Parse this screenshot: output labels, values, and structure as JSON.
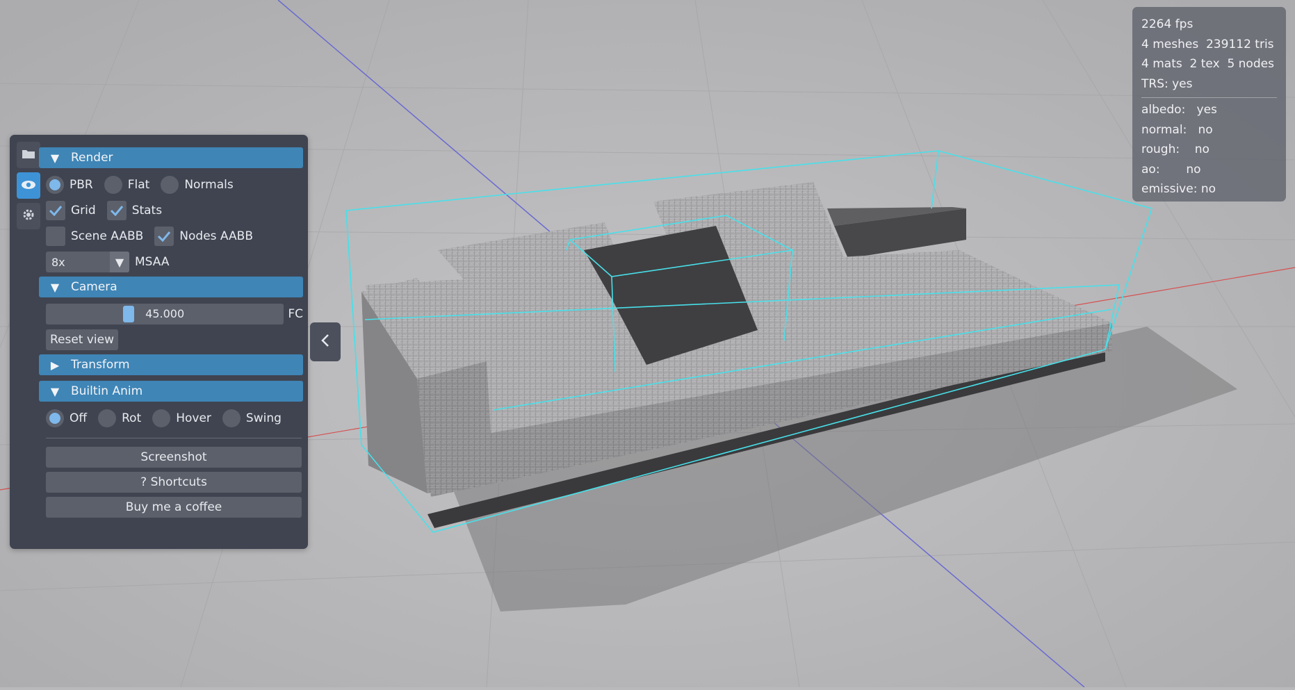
{
  "panel": {
    "tabs": [
      "folder-icon",
      "eye-icon",
      "gear-icon"
    ],
    "render": {
      "header": "Render",
      "shading_options": [
        "PBR",
        "Flat",
        "Normals"
      ],
      "shading_selected": "PBR",
      "checks": [
        {
          "label": "Grid",
          "checked": true
        },
        {
          "label": "Stats",
          "checked": true
        },
        {
          "label": "Scene AABB",
          "checked": false
        },
        {
          "label": "Nodes AABB",
          "checked": true
        }
      ],
      "msaa_value": "8x",
      "msaa_label": "MSAA"
    },
    "camera": {
      "header": "Camera",
      "fov_value": "45.000",
      "fov_label": "FC",
      "reset_label": "Reset view"
    },
    "transform": {
      "header": "Transform"
    },
    "anim": {
      "header": "Builtin Anim",
      "options": [
        "Off",
        "Rot",
        "Hover",
        "Swing"
      ],
      "selected": "Off"
    },
    "buttons": {
      "screenshot": "Screenshot",
      "shortcuts": "? Shortcuts",
      "coffee": "Buy me a coffee"
    }
  },
  "stats": {
    "fps": "2264 fps",
    "meshes": "4 meshes  239112 tris",
    "mats": "4 mats  2 tex  5 nodes",
    "trs": "TRS: yes",
    "albedo": "albedo:   yes",
    "normal": "normal:   no",
    "rough": "rough:    no",
    "ao": "ao:       no",
    "emissive": "emissive: no"
  },
  "colors": {
    "accent": "#3f85b6",
    "aabb": "#48e0ea",
    "panel_bg": "#3f4450"
  }
}
